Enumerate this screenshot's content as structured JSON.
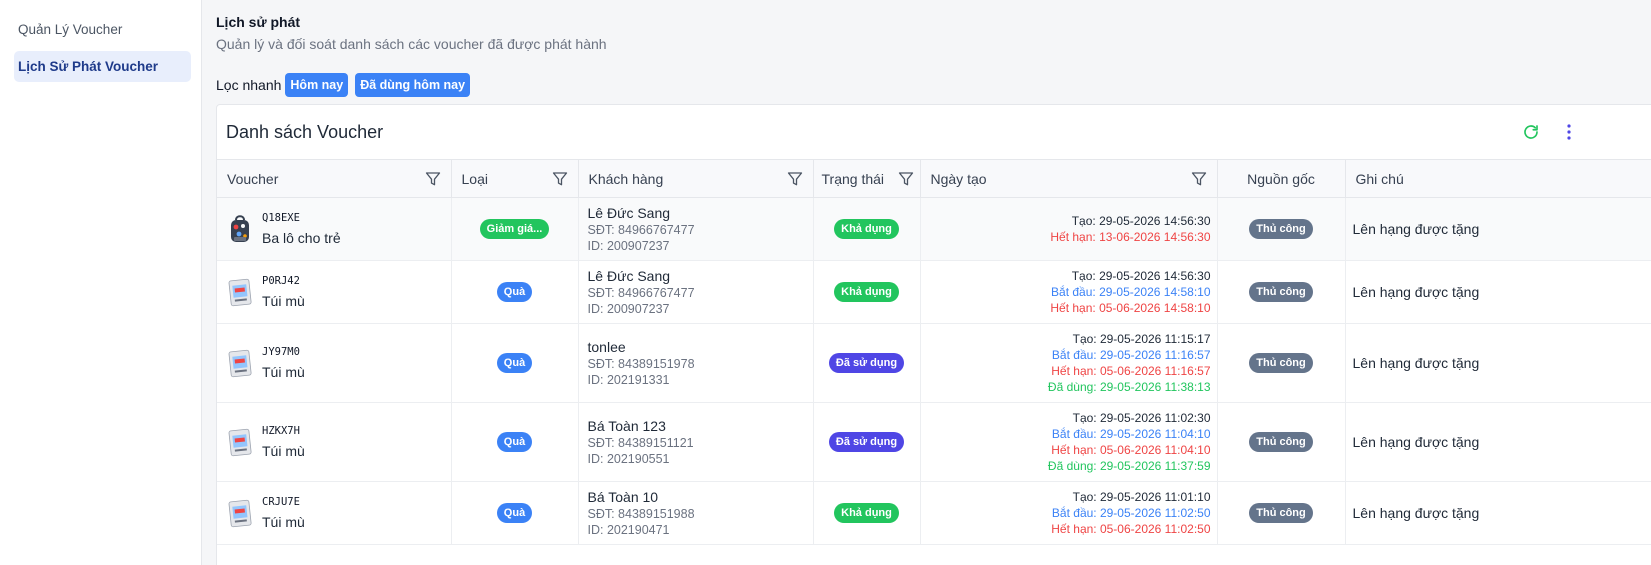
{
  "sidebar": {
    "items": [
      {
        "label": "Quản Lý Voucher",
        "active": false
      },
      {
        "label": "Lịch Sử Phát Voucher",
        "active": true
      }
    ]
  },
  "header": {
    "title": "Lịch sử phát",
    "subtitle": "Quản lý và đối soát danh sách các voucher đã được phát hành"
  },
  "quick_filter": {
    "label": "Lọc nhanh",
    "today": "Hôm nay",
    "used_today": "Đã dùng hôm nay"
  },
  "card": {
    "title": "Danh sách Voucher",
    "icons": [
      "refresh-icon",
      "more-vertical-icon"
    ]
  },
  "columns": {
    "voucher": "Voucher",
    "type": "Loại",
    "customer": "Khách hàng",
    "status": "Trạng thái",
    "created": "Ngày tạo",
    "source": "Nguồn gốc",
    "note": "Ghi chú"
  },
  "colors": {
    "accent": "#3b82f6",
    "available": "#22c55e",
    "used": "#4f46e5",
    "source": "#64748b",
    "expire": "#ef4444"
  },
  "rows": [
    {
      "code": "Q18EXE",
      "name": "Ba lô cho trẻ",
      "thumb": "backpack-icon",
      "type": "Giảm giá...",
      "type_color": "green",
      "customer": "Lê Đức Sang",
      "phone": "SĐT: 84966767477",
      "id": "ID: 200907237",
      "status": "Khả dụng",
      "status_color": "green",
      "created": "Tạo: 29-05-2026 14:56:30",
      "start": "",
      "expire": "Hết hạn: 13-06-2026 14:56:30",
      "used": "",
      "source": "Thủ công",
      "note": "Lên hạng được tặng"
    },
    {
      "code": "P0RJ42",
      "name": "Túi mù",
      "thumb": "blind-bag-icon",
      "type": "Quà",
      "type_color": "blue",
      "customer": "Lê Đức Sang",
      "phone": "SĐT: 84966767477",
      "id": "ID: 200907237",
      "status": "Khả dụng",
      "status_color": "green",
      "created": "Tạo: 29-05-2026 14:56:30",
      "start": "Bắt đầu: 29-05-2026 14:58:10",
      "expire": "Hết hạn: 05-06-2026 14:58:10",
      "used": "",
      "source": "Thủ công",
      "note": "Lên hạng được tặng"
    },
    {
      "code": "JY97M0",
      "name": "Túi mù",
      "thumb": "blind-bag-icon",
      "type": "Quà",
      "type_color": "blue",
      "customer": "tonlee",
      "phone": "SĐT: 84389151978",
      "id": "ID: 202191331",
      "status": "Đã sử dụng",
      "status_color": "indigo",
      "created": "Tạo: 29-05-2026 11:15:17",
      "start": "Bắt đầu: 29-05-2026 11:16:57",
      "expire": "Hết hạn: 05-06-2026 11:16:57",
      "used": "Đã dùng: 29-05-2026 11:38:13",
      "source": "Thủ công",
      "note": "Lên hạng được tặng"
    },
    {
      "code": "HZKX7H",
      "name": "Túi mù",
      "thumb": "blind-bag-icon",
      "type": "Quà",
      "type_color": "blue",
      "customer": "Bá Toàn 123",
      "phone": "SĐT: 84389151121",
      "id": "ID: 202190551",
      "status": "Đã sử dụng",
      "status_color": "indigo",
      "created": "Tạo: 29-05-2026 11:02:30",
      "start": "Bắt đầu: 29-05-2026 11:04:10",
      "expire": "Hết hạn: 05-06-2026 11:04:10",
      "used": "Đã dùng: 29-05-2026 11:37:59",
      "source": "Thủ công",
      "note": "Lên hạng được tặng"
    },
    {
      "code": "CRJU7E",
      "name": "Túi mù",
      "thumb": "blind-bag-icon",
      "type": "Quà",
      "type_color": "blue",
      "customer": "Bá Toàn 10",
      "phone": "SĐT: 84389151988",
      "id": "ID: 202190471",
      "status": "Khả dụng",
      "status_color": "green",
      "created": "Tạo: 29-05-2026 11:01:10",
      "start": "Bắt đầu: 29-05-2026 11:02:50",
      "expire": "Hết hạn: 05-06-2026 11:02:50",
      "used": "",
      "source": "Thủ công",
      "note": "Lên hạng được tặng"
    }
  ]
}
